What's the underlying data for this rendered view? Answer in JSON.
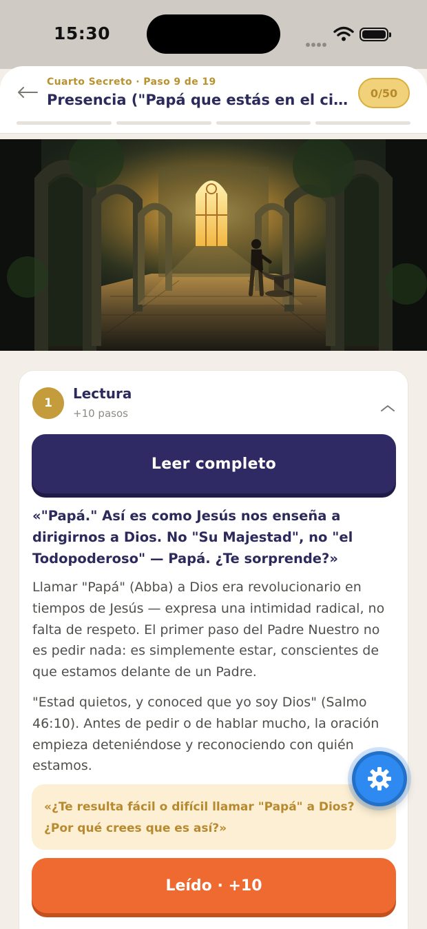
{
  "status_bar": {
    "time": "15:30"
  },
  "header": {
    "step_label": "Cuarto Secreto · Paso 9 de 19",
    "title": "Presencia (\"Papá que estás en el ciel...",
    "points": "0/50"
  },
  "section": {
    "number": "1",
    "title": "Lectura",
    "subtitle": "+10 pasos",
    "read_full_label": "Leer completo",
    "quote": "«\"Papá.\" Así es como Jesús nos enseña a dirigirnos a Dios. No \"Su Majestad\", no \"el Todopoderoso\" — Papá. ¿Te sorprende?»",
    "paragraph_1": "Llamar \"Papá\" (Abba) a Dios era revolucionario en tiempos de Jesús — expresa una intimidad radical, no falta de respeto. El primer paso del Padre Nuestro no es pedir nada: es simplemente estar, conscientes de que estamos delante de un Padre.",
    "paragraph_2": "\"Estad quietos, y conoced que yo soy Dios\" (Salmo 46:10). Antes de pedir o de hablar mucho, la oración empieza deteniéndose y reconociendo con quién estamos.",
    "reflection": "«¿Te resulta fácil o difícil llamar \"Papá\" a Dios? ¿Por qué crees que es así?»",
    "done_label": "Leído · +10"
  },
  "icons": {
    "back": "arrow-left-icon",
    "collapse": "chevron-up-icon",
    "settings": "gear-icon"
  },
  "colors": {
    "primary": "#2f2a63",
    "accent_gold": "#c59c3c",
    "action_orange": "#ee6a30",
    "fab_blue": "#2e8af0"
  }
}
